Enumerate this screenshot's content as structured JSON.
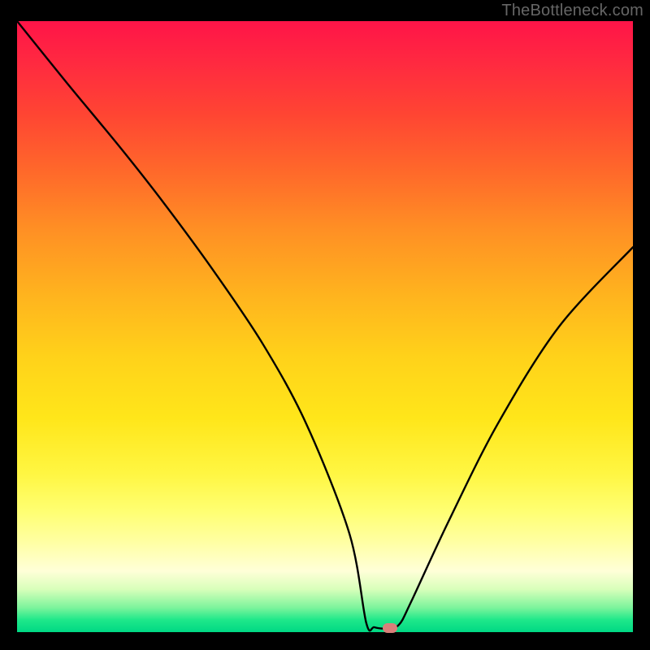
{
  "watermark": "TheBottleneck.com",
  "chart_data": {
    "type": "line",
    "title": "",
    "xlabel": "",
    "ylabel": "",
    "xlim": [
      0,
      100
    ],
    "ylim": [
      0,
      100
    ],
    "series": [
      {
        "name": "bottleneck-curve",
        "x": [
          0,
          8,
          17,
          24,
          32,
          40,
          47,
          54,
          56.7,
          58,
          60,
          62,
          64,
          70,
          78,
          88,
          100
        ],
        "values": [
          100,
          90,
          79,
          70,
          59,
          47,
          34,
          16,
          1.5,
          0.8,
          0.6,
          1.2,
          5,
          18,
          34,
          50,
          63
        ]
      }
    ],
    "marker": {
      "x": 60.5,
      "y": 0.7,
      "color": "#d9807a"
    },
    "gradient_stops": [
      {
        "pos": 0,
        "color": "#ff1448"
      },
      {
        "pos": 50,
        "color": "#ffd21a"
      },
      {
        "pos": 86,
        "color": "#ffff90"
      },
      {
        "pos": 100,
        "color": "#00d884"
      }
    ],
    "grid": false,
    "legend": false
  }
}
